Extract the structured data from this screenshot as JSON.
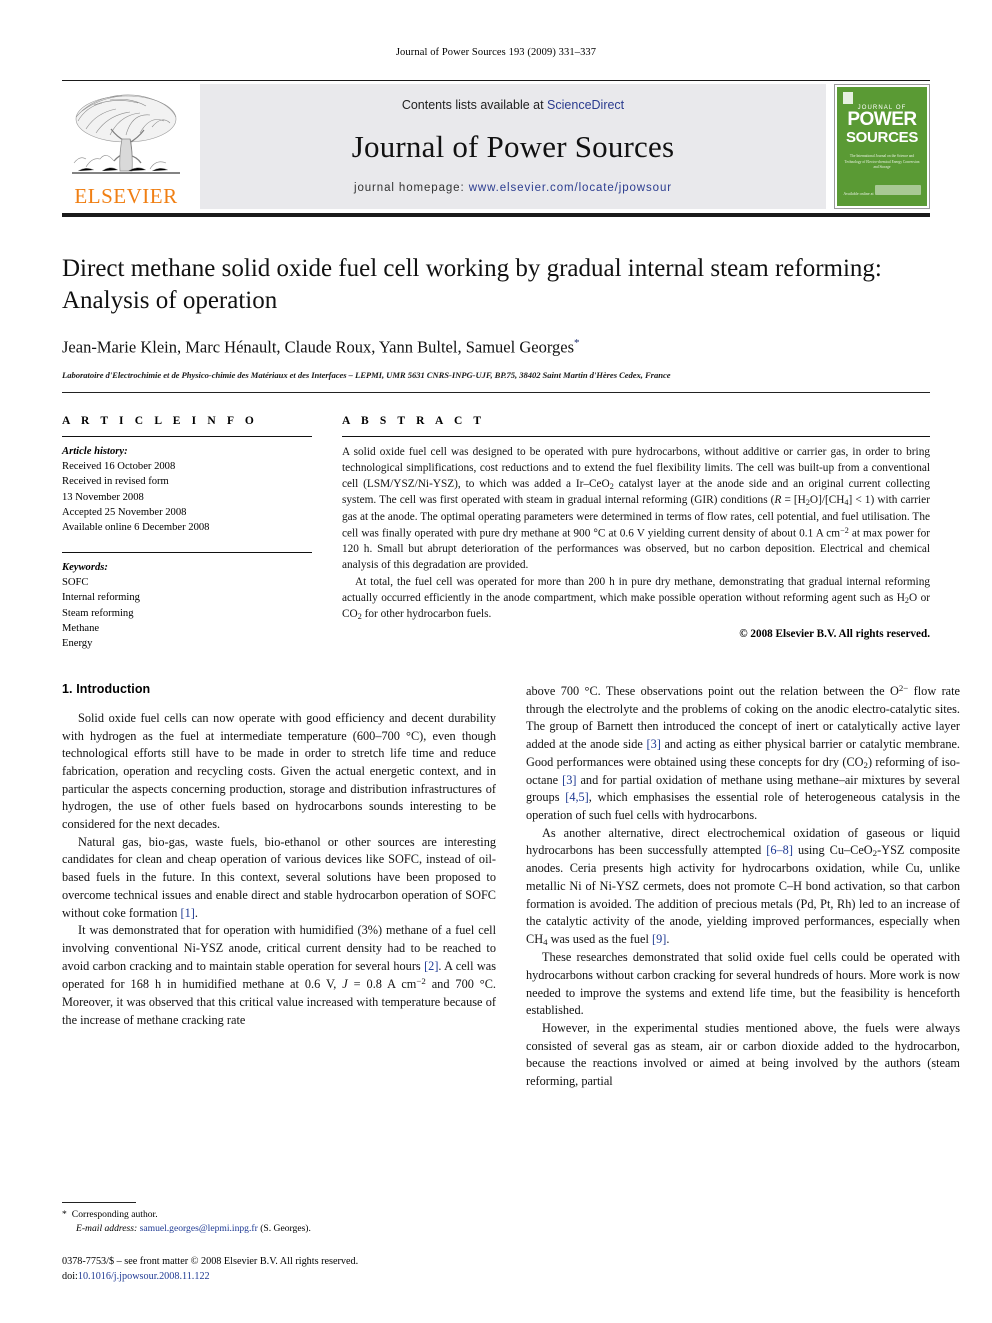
{
  "running_head": "Journal of Power Sources 193 (2009) 331–337",
  "masthead": {
    "publisher_name": "ELSEVIER",
    "contents_prefix": "Contents lists available at ",
    "contents_link": "ScienceDirect",
    "journal_name": "Journal of Power Sources",
    "homepage_prefix": "journal homepage: ",
    "homepage_url": "www.elsevier.com/locate/jpowsour",
    "cover": {
      "line_top": "JOURNAL OF",
      "line_1": "POWER",
      "line_2": "SOURCES",
      "subtitle": "The International Journal on the Science and Technology of Electro-chemical Energy Conversion and Storage",
      "footer": "Available online at"
    }
  },
  "article": {
    "title": "Direct methane solid oxide fuel cell working by gradual internal steam reforming: Analysis of operation",
    "authors": "Jean-Marie Klein, Marc Hénault, Claude Roux, Yann Bultel, Samuel Georges",
    "corresponding_marker": "*",
    "affiliation": "Laboratoire d'Electrochimie et de Physico-chimie des Matériaux et des Interfaces – LEPMI, UMR 5631 CNRS-INPG-UJF, BP.75, 38402 Saint Martin d'Hères Cedex, France"
  },
  "article_info": {
    "heading": "A R T I C L E   I N F O",
    "history_label": "Article history:",
    "history": [
      "Received 16 October 2008",
      "Received in revised form",
      "13 November 2008",
      "Accepted 25 November 2008",
      "Available online 6 December 2008"
    ],
    "keywords_label": "Keywords:",
    "keywords": [
      "SOFC",
      "Internal reforming",
      "Steam reforming",
      "Methane",
      "Energy"
    ]
  },
  "abstract": {
    "heading": "A B S T R A C T",
    "paragraph_1": "A solid oxide fuel cell was designed to be operated with pure hydrocarbons, without additive or carrier gas, in order to bring technological simplifications, cost reductions and to extend the fuel flexibility limits. The cell was built-up from a conventional cell (LSM/YSZ/Ni-YSZ), to which was added a Ir–CeO2 catalyst layer at the anode side and an original current collecting system. The cell was first operated with steam in gradual internal reforming (GIR) conditions (R = [H2O]/[CH4] < 1) with carrier gas at the anode. The optimal operating parameters were determined in terms of flow rates, cell potential, and fuel utilisation. The cell was finally operated with pure dry methane at 900 °C at 0.6 V yielding current density of about 0.1 A cm−2 at max power for 120 h. Small but abrupt deterioration of the performances was observed, but no carbon deposition. Electrical and chemical analysis of this degradation are provided.",
    "paragraph_2": "At total, the fuel cell was operated for more than 200 h in pure dry methane, demonstrating that gradual internal reforming actually occurred efficiently in the anode compartment, which make possible operation without reforming agent such as H2O or CO2 for other hydrocarbon fuels.",
    "copyright": "© 2008 Elsevier B.V. All rights reserved."
  },
  "body": {
    "section_number_title": "1.  Introduction",
    "left_paragraphs": [
      "Solid oxide fuel cells can now operate with good efficiency and decent durability with hydrogen as the fuel at intermediate temperature (600–700 °C), even though technological efforts still have to be made in order to stretch life time and reduce fabrication, operation and recycling costs. Given the actual energetic context, and in particular the aspects concerning production, storage and distribution infrastructures of hydrogen, the use of other fuels based on hydrocarbons sounds interesting to be considered for the next decades.",
      "Natural gas, bio-gas, waste fuels, bio-ethanol or other sources are interesting candidates for clean and cheap operation of various devices like SOFC, instead of oil-based fuels in the future. In this context, several solutions have been proposed to overcome technical issues and enable direct and stable hydrocarbon operation of SOFC without coke formation [1].",
      "It was demonstrated that for operation with humidified (3%) methane of a fuel cell involving conventional Ni-YSZ anode, critical current density had to be reached to avoid carbon cracking and to maintain stable operation for several hours [2]. A cell was operated for 168 h in humidified methane at 0.6 V, J = 0.8 A cm−2 and 700 °C. Moreover, it was observed that this critical value increased with temperature because of the increase of methane cracking rate"
    ],
    "right_paragraphs": [
      "above 700 °C. These observations point out the relation between the O2− flow rate through the electrolyte and the problems of coking on the anodic electro-catalytic sites. The group of Barnett then introduced the concept of inert or catalytically active layer added at the anode side [3] and acting as either physical barrier or catalytic membrane. Good performances were obtained using these concepts for dry (CO2) reforming of iso-octane [3] and for partial oxidation of methane using methane–air mixtures by several groups [4,5], which emphasises the essential role of heterogeneous catalysis in the operation of such fuel cells with hydrocarbons.",
      "As another alternative, direct electrochemical oxidation of gaseous or liquid hydrocarbons has been successfully attempted [6–8] using Cu–CeO2-YSZ composite anodes. Ceria presents high activity for hydrocarbons oxidation, while Cu, unlike metallic Ni of Ni-YSZ cermets, does not promote C–H bond activation, so that carbon formation is avoided. The addition of precious metals (Pd, Pt, Rh) led to an increase of the catalytic activity of the anode, yielding improved performances, especially when CH4 was used as the fuel [9].",
      "These researches demonstrated that solid oxide fuel cells could be operated with hydrocarbons without carbon cracking for several hundreds of hours. More work is now needed to improve the systems and extend life time, but the feasibility is henceforth established.",
      "However, in the experimental studies mentioned above, the fuels were always consisted of several gas as steam, air or carbon dioxide added to the hydrocarbon, because the reactions involved or aimed at being involved by the authors (steam reforming, partial"
    ]
  },
  "footnotes": {
    "corresponding_marker": "*",
    "corresponding_label": "Corresponding author.",
    "email_label": "E-mail address:",
    "email": "samuel.georges@lepmi.inpg.fr",
    "email_person": "(S. Georges).",
    "issn_line": "0378-7753/$ – see front matter © 2008 Elsevier B.V. All rights reserved.",
    "doi_label": "doi:",
    "doi_value": "10.1016/j.jpowsour.2008.11.122"
  },
  "colors": {
    "link": "#1f3a93",
    "elsevier_orange": "#f07f13",
    "cover_green": "#5a9a34",
    "masthead_grey": "#e9e9ec"
  }
}
